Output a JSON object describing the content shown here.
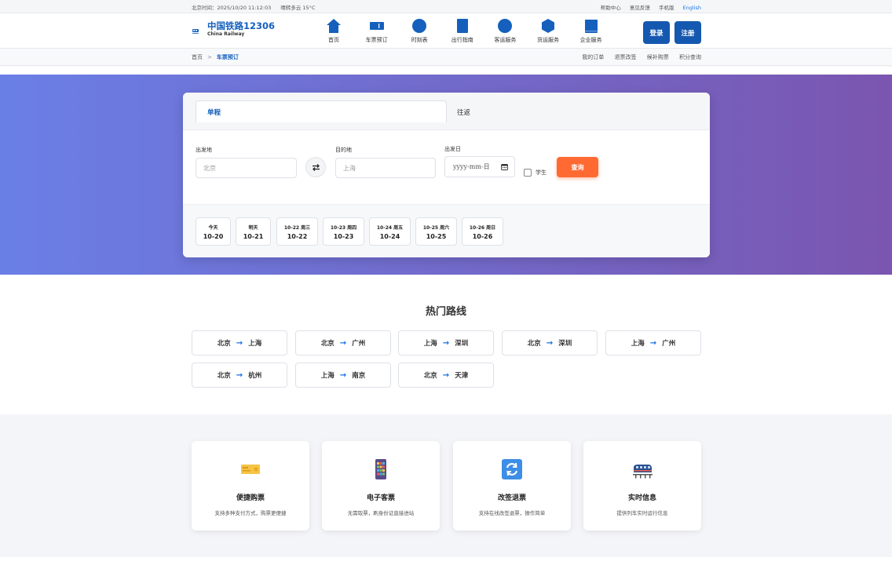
{
  "topbar": {
    "time": "北京时间：2025/10/20 11:12:03",
    "weather": "晴转多云 15°C",
    "links": [
      "帮助中心",
      "意见反馈",
      "手机版",
      "English"
    ]
  },
  "header": {
    "logo_title": "中国铁路12306",
    "logo_sub": "China Railway",
    "nav": [
      {
        "label": "首页",
        "icon": "home-icon"
      },
      {
        "label": "车票预订",
        "icon": "ticket-icon"
      },
      {
        "label": "时刻表",
        "icon": "clock-icon"
      },
      {
        "label": "出行指南",
        "icon": "book-icon"
      },
      {
        "label": "客运服务",
        "icon": "globe-icon"
      },
      {
        "label": "货运服务",
        "icon": "cube-icon"
      },
      {
        "label": "企业服务",
        "icon": "building-icon"
      }
    ],
    "login": "登录",
    "register": "注册",
    "accent": "#1558b0"
  },
  "breadcrumb": {
    "home": "首页",
    "sep": ">",
    "current": "车票预订",
    "quick": [
      "我的订单",
      "退票改签",
      "候补购票",
      "积分查询"
    ]
  },
  "search": {
    "tab_single": "单程",
    "tab_round": "往返",
    "from_label": "出发地",
    "from_value": "北京",
    "to_label": "目的地",
    "to_value": "上海",
    "date_label": "出发日",
    "date_placeholder": "yyyy-mm-日",
    "student_label": "学生",
    "query_button": "查询",
    "dates": [
      {
        "top": "今天",
        "date": "10-20"
      },
      {
        "top": "明天",
        "date": "10-21"
      },
      {
        "top": "10-22 周三",
        "date": "10-22"
      },
      {
        "top": "10-23 周四",
        "date": "10-23"
      },
      {
        "top": "10-24 周五",
        "date": "10-24"
      },
      {
        "top": "10-25 周六",
        "date": "10-25"
      },
      {
        "top": "10-26 周日",
        "date": "10-26"
      }
    ]
  },
  "hot_routes": {
    "title": "热门路线",
    "arrow": "→",
    "routes": [
      {
        "from": "北京",
        "to": "上海"
      },
      {
        "from": "北京",
        "to": "广州"
      },
      {
        "from": "上海",
        "to": "深圳"
      },
      {
        "from": "北京",
        "to": "深圳"
      },
      {
        "from": "上海",
        "to": "广州"
      },
      {
        "from": "北京",
        "to": "杭州"
      },
      {
        "from": "上海",
        "to": "南京"
      },
      {
        "from": "北京",
        "to": "天津"
      }
    ]
  },
  "features": [
    {
      "title": "便捷购票",
      "desc": "支持多种支付方式，购票更便捷",
      "icon": "ticket-card-icon"
    },
    {
      "title": "电子客票",
      "desc": "无需取票，刷身份证直接进站",
      "icon": "phone-app-icon"
    },
    {
      "title": "改签退票",
      "desc": "支持在线改签退票，操作简单",
      "icon": "refresh-icon"
    },
    {
      "title": "实时信息",
      "desc": "提供列车实时运行信息",
      "icon": "train-icon"
    }
  ],
  "colors": {
    "hero_start": "#6a7fe6",
    "hero_end": "#7a56b0",
    "query": "#ff6a33",
    "link": "#1560bd"
  }
}
